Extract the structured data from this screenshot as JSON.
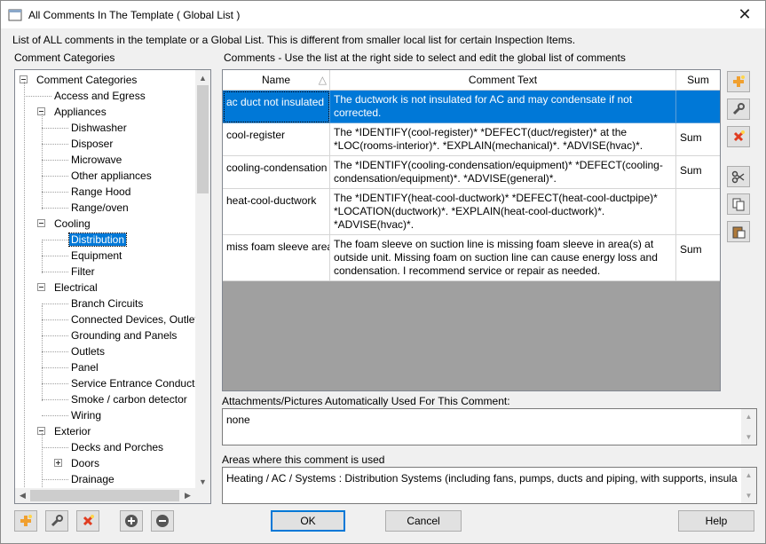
{
  "window": {
    "title": "All Comments In The Template ( Global List )",
    "close_glyph": "✕"
  },
  "description": "List of ALL comments in the template or a Global List.  This is different from smaller local list for certain Inspection Items.",
  "categories_label": "Comment Categories",
  "grid_label": "Comments - Use the list at the right side to select and edit the global list of comments",
  "tree": {
    "items": [
      {
        "label": "Comment Categories",
        "level": 0,
        "expander": "minus"
      },
      {
        "label": "Access and Egress",
        "level": 1,
        "expander": "none"
      },
      {
        "label": "Appliances",
        "level": 1,
        "expander": "minus"
      },
      {
        "label": "Dishwasher",
        "level": 2,
        "expander": "none"
      },
      {
        "label": "Disposer",
        "level": 2,
        "expander": "none"
      },
      {
        "label": "Microwave",
        "level": 2,
        "expander": "none"
      },
      {
        "label": "Other appliances",
        "level": 2,
        "expander": "none"
      },
      {
        "label": "Range Hood",
        "level": 2,
        "expander": "none"
      },
      {
        "label": "Range/oven",
        "level": 2,
        "expander": "none"
      },
      {
        "label": "Cooling",
        "level": 1,
        "expander": "minus"
      },
      {
        "label": "Distribution",
        "level": 2,
        "expander": "none",
        "selected": true
      },
      {
        "label": "Equipment",
        "level": 2,
        "expander": "none"
      },
      {
        "label": "Filter",
        "level": 2,
        "expander": "none"
      },
      {
        "label": "Electrical",
        "level": 1,
        "expander": "minus"
      },
      {
        "label": "Branch Circuits",
        "level": 2,
        "expander": "none"
      },
      {
        "label": "Connected Devices, Outlet",
        "level": 2,
        "expander": "none"
      },
      {
        "label": "Grounding and Panels",
        "level": 2,
        "expander": "none"
      },
      {
        "label": "Outlets",
        "level": 2,
        "expander": "none"
      },
      {
        "label": "Panel",
        "level": 2,
        "expander": "none"
      },
      {
        "label": "Service Entrance Conducto",
        "level": 2,
        "expander": "none"
      },
      {
        "label": "Smoke / carbon detector",
        "level": 2,
        "expander": "none"
      },
      {
        "label": "Wiring",
        "level": 2,
        "expander": "none"
      },
      {
        "label": "Exterior",
        "level": 1,
        "expander": "minus"
      },
      {
        "label": "Decks and Porches",
        "level": 2,
        "expander": "none"
      },
      {
        "label": "Doors",
        "level": 2,
        "expander": "plus"
      },
      {
        "label": "Drainage",
        "level": 2,
        "expander": "none"
      }
    ]
  },
  "grid": {
    "columns": {
      "name": "Name",
      "text": "Comment Text",
      "sum": "Sum"
    },
    "sort_glyph": "△",
    "rows": [
      {
        "name": "ac duct not insulated",
        "text": "The ductwork is not insulated for AC and may condensate if not corrected.",
        "sum": "",
        "selected": true
      },
      {
        "name": "cool-register",
        "text": "The *IDENTIFY(cool-register)* *DEFECT(duct/register)* at the *LOC(rooms-interior)*. *EXPLAIN(mechanical)*. *ADVISE(hvac)*.",
        "sum": "Sum"
      },
      {
        "name": "cooling-condensation",
        "text": "The *IDENTIFY(cooling-condensation/equipment)* *DEFECT(cooling-condensation/equipment)*. *ADVISE(general)*.",
        "sum": "Sum"
      },
      {
        "name": "heat-cool-ductwork",
        "text": "The *IDENTIFY(heat-cool-ductwork)* *DEFECT(heat-cool-ductpipe)* *LOCATION(ductwork)*. *EXPLAIN(heat-cool-ductwork)*. *ADVISE(hvac)*.",
        "sum": ""
      },
      {
        "name": "miss foam sleeve area",
        "text": "The foam sleeve on suction line is missing foam sleeve in area(s) at outside unit. Missing foam on suction line can cause energy loss and condensation. I recommend service or repair as needed.",
        "sum": "Sum"
      }
    ]
  },
  "attachments": {
    "label": "Attachments/Pictures Automatically Used For This Comment:",
    "value": "none"
  },
  "areas": {
    "label": "Areas where this comment is used",
    "value": "Heating / AC / Systems : Distribution Systems (including fans, pumps, ducts and piping, with supports, insula"
  },
  "buttons": {
    "ok": "OK",
    "cancel": "Cancel",
    "help": "Help"
  },
  "icons": {
    "side": [
      "add-icon",
      "edit-wrench-icon",
      "delete-icon",
      "cut-icon",
      "copy-icon",
      "paste-icon"
    ],
    "bottom": [
      "add-icon",
      "edit-wrench-icon",
      "delete-icon",
      "plus-circle-icon",
      "minus-circle-icon"
    ],
    "accent_color": "#0078d7",
    "add_color": "#f0a030",
    "delete_color": "#e03c20"
  }
}
